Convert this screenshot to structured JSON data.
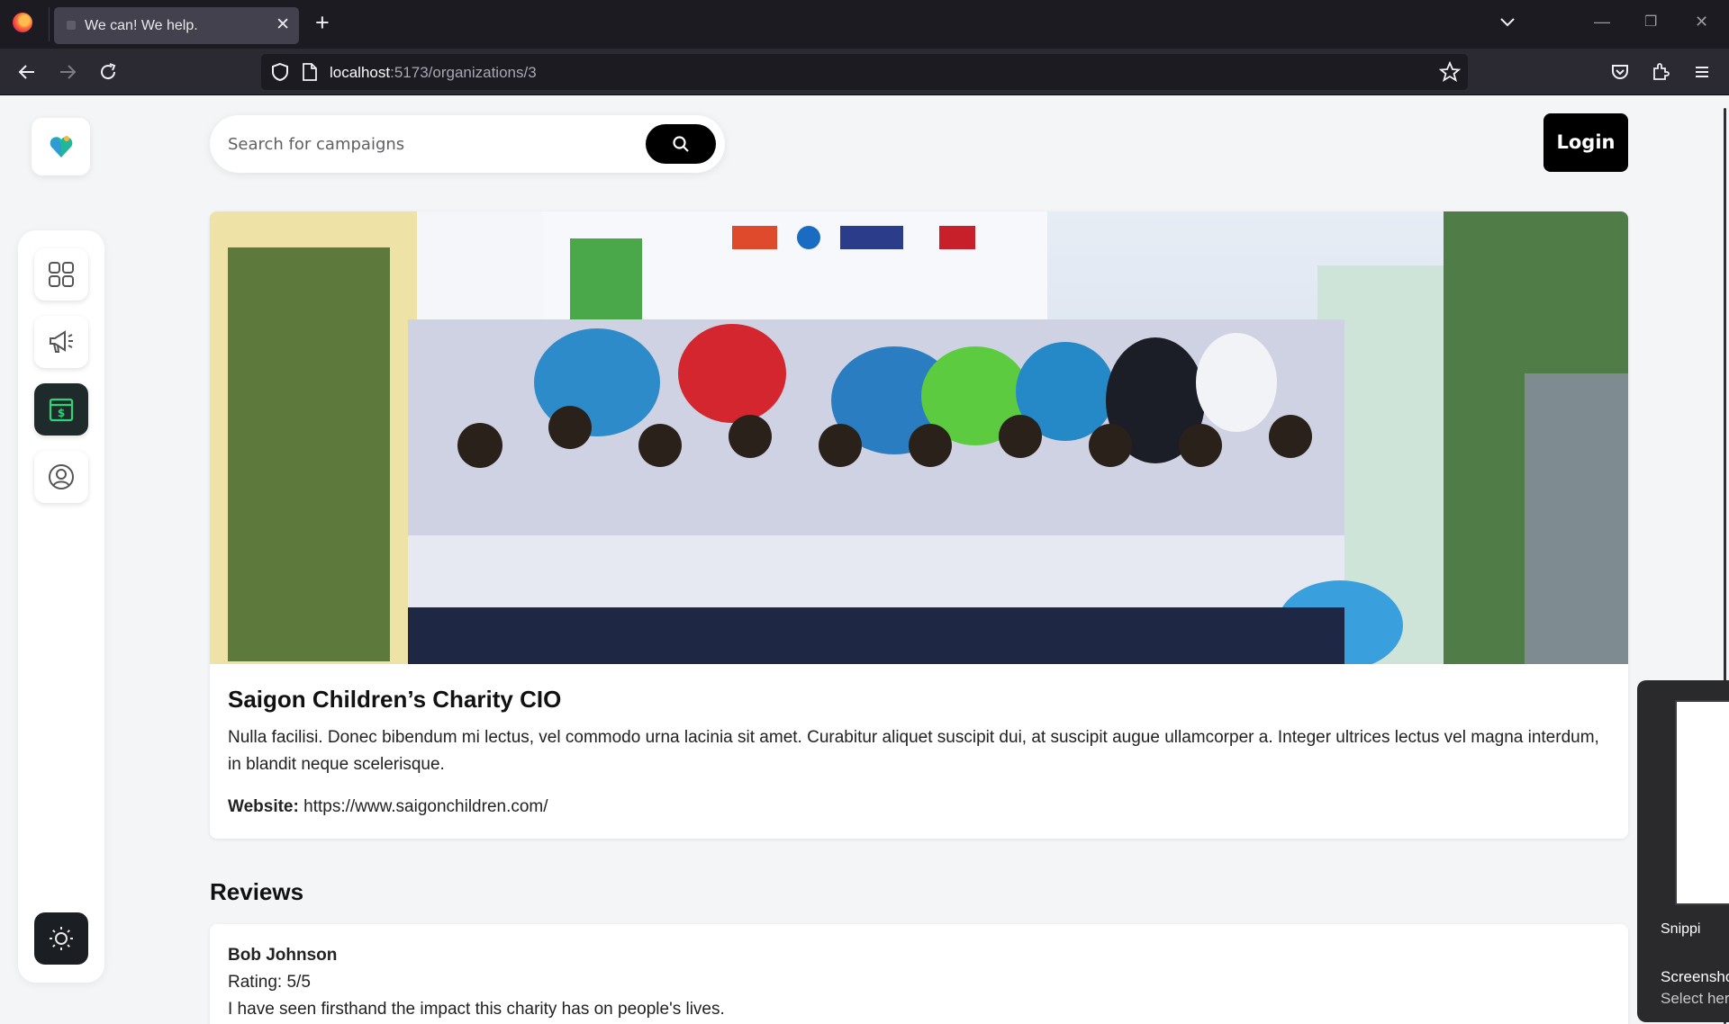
{
  "browser": {
    "tab_title": "We can! We help.",
    "url_host": "localhost",
    "url_path": ":5173/organizations/3"
  },
  "search": {
    "placeholder": "Search for campaigns"
  },
  "header": {
    "login_label": "Login"
  },
  "sidebar": {
    "items": [
      {
        "name": "dashboard",
        "icon": "grid-icon"
      },
      {
        "name": "campaigns",
        "icon": "megaphone-icon"
      },
      {
        "name": "organizations",
        "icon": "donation-icon",
        "active": true
      },
      {
        "name": "profile",
        "icon": "user-circle-icon"
      }
    ],
    "theme_icon": "sun-icon"
  },
  "organization": {
    "name": "Saigon Children’s Charity CIO",
    "description": "Nulla facilisi. Donec bibendum mi lectus, vel commodo urna lacinia sit amet. Curabitur aliquet suscipit dui, at suscipit augue ullamcorper a. Integer ultrices lectus vel magna interdum, in blandit neque scelerisque.",
    "website_label": "Website:",
    "website_url": "https://www.saigonchildren.com/"
  },
  "reviews": {
    "title": "Reviews",
    "items": [
      {
        "author": "Bob Johnson",
        "rating": "Rating: 5/5",
        "text": "I have seen firsthand the impact this charity has on people's lives."
      }
    ]
  },
  "snipping_popup": {
    "app_name": "Snippi",
    "title": "Screensho",
    "subtitle": "Select her"
  },
  "colors": {
    "accent": "#1fb89a",
    "active_nav": "#1f2a2a",
    "active_nav_icon": "#2ed47a",
    "page_bg": "#f4f5f7"
  }
}
